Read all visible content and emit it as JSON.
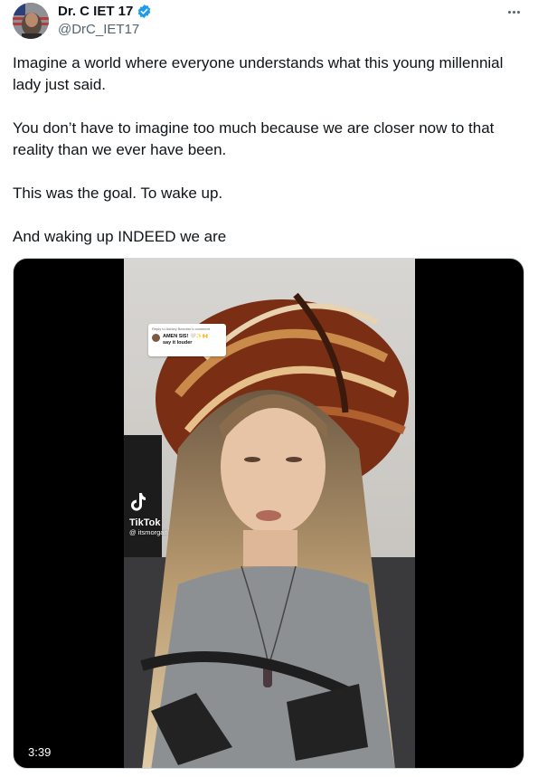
{
  "author": {
    "display_name": "Dr. C IET 17",
    "handle": "@DrC_IET17",
    "verified": true
  },
  "tweet": {
    "paragraphs": [
      "Imagine a world where everyone understands what this young millennial lady just said.",
      "You don’t have to imagine too much because we are closer now to that reality than we ever have been.",
      "This was the goal. To wake up.",
      "And waking up INDEED we are"
    ]
  },
  "media": {
    "duration": "3:39",
    "comment": {
      "reply_to": "Reply to Ashley Beecher's comment",
      "text_line1": "AMEN SIS!",
      "emoji": "🤍✨🙌",
      "text_line2": "say it louder"
    },
    "watermark": {
      "brand": "TikTok",
      "username": "@ itsmorgan"
    }
  },
  "icons": {
    "verified": "verified-badge-icon",
    "more": "more-options-icon",
    "tiktok": "tiktok-logo-icon"
  },
  "colors": {
    "verified_blue": "#1d9bf0",
    "text": "#0f1419",
    "secondary_text": "#536471"
  }
}
